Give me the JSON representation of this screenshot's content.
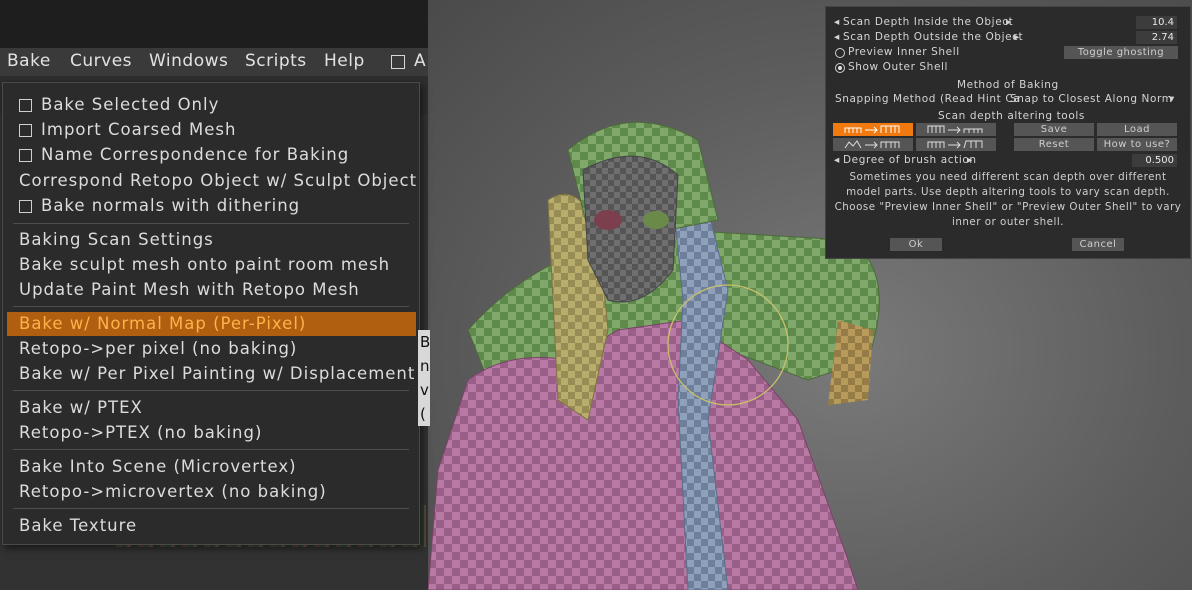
{
  "menubar": {
    "items": [
      "Bake",
      "Curves",
      "Windows",
      "Scripts",
      "Help"
    ],
    "trailing": "A"
  },
  "bake_menu": {
    "items": [
      {
        "label": "Bake Selected Only",
        "checkbox": true
      },
      {
        "label": "Import Coarsed Mesh",
        "checkbox": true
      },
      {
        "label": "Name Correspondence for Baking",
        "checkbox": true
      },
      {
        "label": "Correspond Retopo Object w/ Sculpt Object",
        "checkbox": false
      },
      {
        "label": "Bake normals with dithering",
        "checkbox": true
      },
      {
        "label": "Baking Scan Settings",
        "checkbox": false
      },
      {
        "label": "Bake sculpt mesh onto paint room mesh",
        "checkbox": false
      },
      {
        "label": "Update Paint Mesh with Retopo Mesh",
        "checkbox": false
      },
      {
        "label": "Bake w/ Normal Map (Per-Pixel)",
        "checkbox": false,
        "highlighted": true
      },
      {
        "label": "Retopo->per pixel (no baking)",
        "checkbox": false
      },
      {
        "label": "Bake w/ Per Pixel Painting w/ Displacement",
        "checkbox": false
      },
      {
        "label": "Bake w/ PTEX",
        "checkbox": false
      },
      {
        "label": "Retopo->PTEX (no baking)",
        "checkbox": false
      },
      {
        "label": "Bake Into Scene (Microvertex)",
        "checkbox": false
      },
      {
        "label": "Retopo->microvertex (no baking)",
        "checkbox": false
      },
      {
        "label": "Bake Texture",
        "checkbox": false
      }
    ],
    "highlight_color": "#b05e10"
  },
  "peek_panel": {
    "lines": [
      "B",
      "n",
      "v",
      "("
    ]
  },
  "scan_panel": {
    "depth_inside_label": "Scan Depth Inside the Object",
    "depth_inside_value": "10.4",
    "depth_outside_label": "Scan Depth Outside the Object",
    "depth_outside_value": "2.74",
    "preview_inner": "Preview Inner Shell",
    "show_outer": "Show Outer Shell",
    "toggle_ghosting": "Toggle ghosting",
    "method_title": "Method of Baking",
    "snapping_label": "Snapping Method (Read Hint Ca",
    "snapping_value": "Snap to Closest Along Norm",
    "tools_title": "Scan depth altering tools",
    "save": "Save",
    "load": "Load",
    "reset": "Reset",
    "how_to_use": "How to use?",
    "brush_label": "Degree of brush action",
    "brush_value": "0.500",
    "description": [
      "Sometimes you need different scan depth over different",
      "model parts. Use depth altering tools to vary scan depth.",
      "Choose \"Preview Inner Shell\" or \"Preview Outer Shell\" to vary",
      "inner or outer shell."
    ],
    "ok": "Ok",
    "cancel": "Cancel",
    "accent_color": "#f07a10"
  }
}
